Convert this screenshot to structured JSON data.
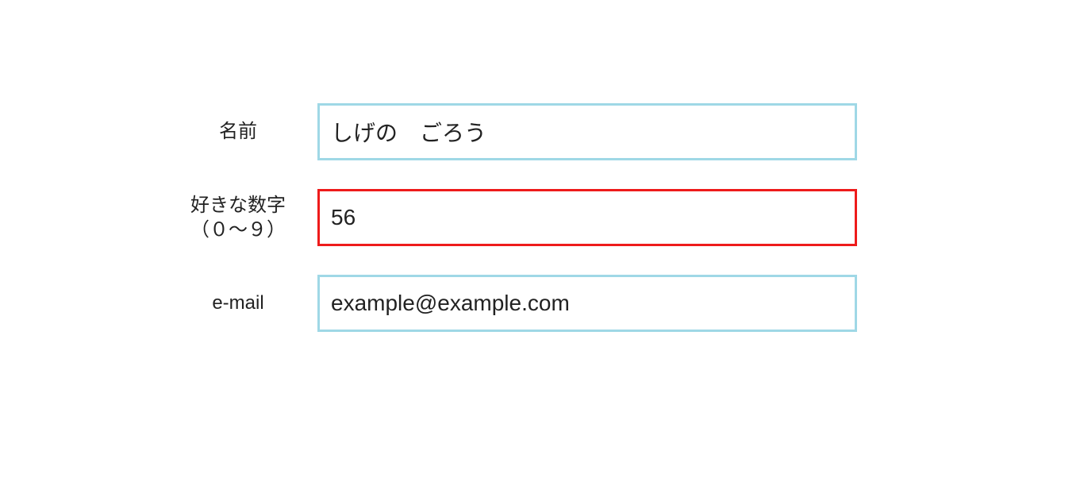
{
  "form": {
    "fields": [
      {
        "label": "名前",
        "value": "しげの　ごろう",
        "invalid": false
      },
      {
        "label": "好きな数字\n（０～９）",
        "value": "56",
        "invalid": true
      },
      {
        "label": "e-mail",
        "value": "example@example.com",
        "invalid": false
      }
    ]
  },
  "colors": {
    "normal_border": "#9fd8e6",
    "error_border": "#ee1b1b"
  }
}
